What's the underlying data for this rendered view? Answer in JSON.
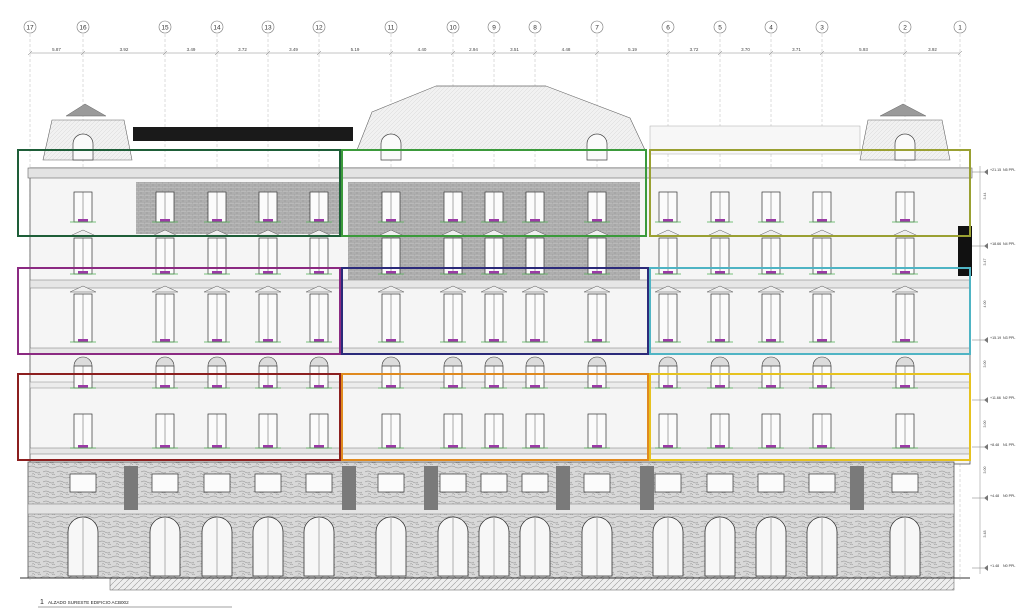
{
  "drawing": {
    "grid_axes": [
      "17",
      "16",
      "15",
      "14",
      "13",
      "12",
      "11",
      "10",
      "9",
      "8",
      "7",
      "6",
      "5",
      "4",
      "3",
      "2",
      "1"
    ],
    "bay_dims": [
      "5.87",
      "3.92",
      "3.49",
      "3.72",
      "3.49",
      "5.19",
      "4.40",
      "2.94",
      "3.51",
      "4.48",
      "5.19",
      "3.72",
      "3.70",
      "3.71",
      "5.93",
      "3.92"
    ],
    "level_marks": [
      {
        "elev": "+21.15",
        "label": "N5 PPL"
      },
      {
        "elev": "+18.66",
        "label": "N4 PPL"
      },
      {
        "elev": "+15.19",
        "label": "N3 PPL"
      },
      {
        "elev": "+11.66",
        "label": "N2 PPL"
      },
      {
        "elev": "+8.48",
        "label": "N1 PPL"
      },
      {
        "elev": "+4.48",
        "label": "N0 PPL"
      },
      {
        "elev": "+1.48",
        "label": "N0 PPL"
      }
    ],
    "story_heights": [
      "3.44",
      "3.47",
      "4.00",
      "3.00",
      "3.00",
      "3.00",
      "3.48"
    ],
    "caption_number": "1",
    "caption_title": "ALZADO SURESTE EDIFICIO ACB002",
    "highlight_colors": [
      "#1e5e38",
      "#3b9a3b",
      "#9aa032",
      "#8b2a82",
      "#2b2a7a",
      "#4fb4c4",
      "#8c1f1f",
      "#e08a1f",
      "#e6c21f"
    ]
  }
}
